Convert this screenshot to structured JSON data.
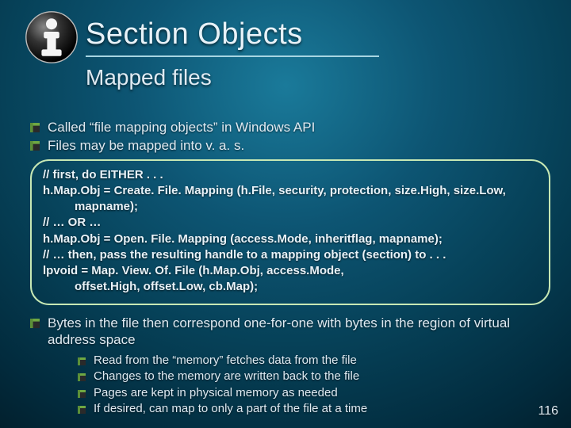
{
  "title": "Section Objects",
  "subtitle": "Mapped files",
  "bullets1": [
    "Called “file mapping objects” in Windows API",
    "Files may be mapped into v. a. s."
  ],
  "code": {
    "l1": "// first, do EITHER . . .",
    "l2": "h.Map.Obj = Create. File. Mapping (h.File, security, protection, size.High, size.Low,",
    "l2b": "mapname);",
    "l3": "// … OR …",
    "l4": "h.Map.Obj = Open. File. Mapping (access.Mode, inheritflag, mapname);",
    "l5": "// … then, pass the resulting handle to a mapping object (section) to . . .",
    "l6": "lpvoid = Map. View. Of. File (h.Map.Obj, access.Mode,",
    "l6b": "offset.High, offset.Low, cb.Map);"
  },
  "bullet_after": "Bytes in the file then correspond one-for-one with bytes in the region of virtual address space",
  "sub_bullets": [
    "Read from the “memory” fetches data from the file",
    "Changes to the memory are written back to the file",
    "Pages are kept in physical memory as needed",
    "If desired, can map to only a part of the file at a time"
  ],
  "page_number": "116"
}
